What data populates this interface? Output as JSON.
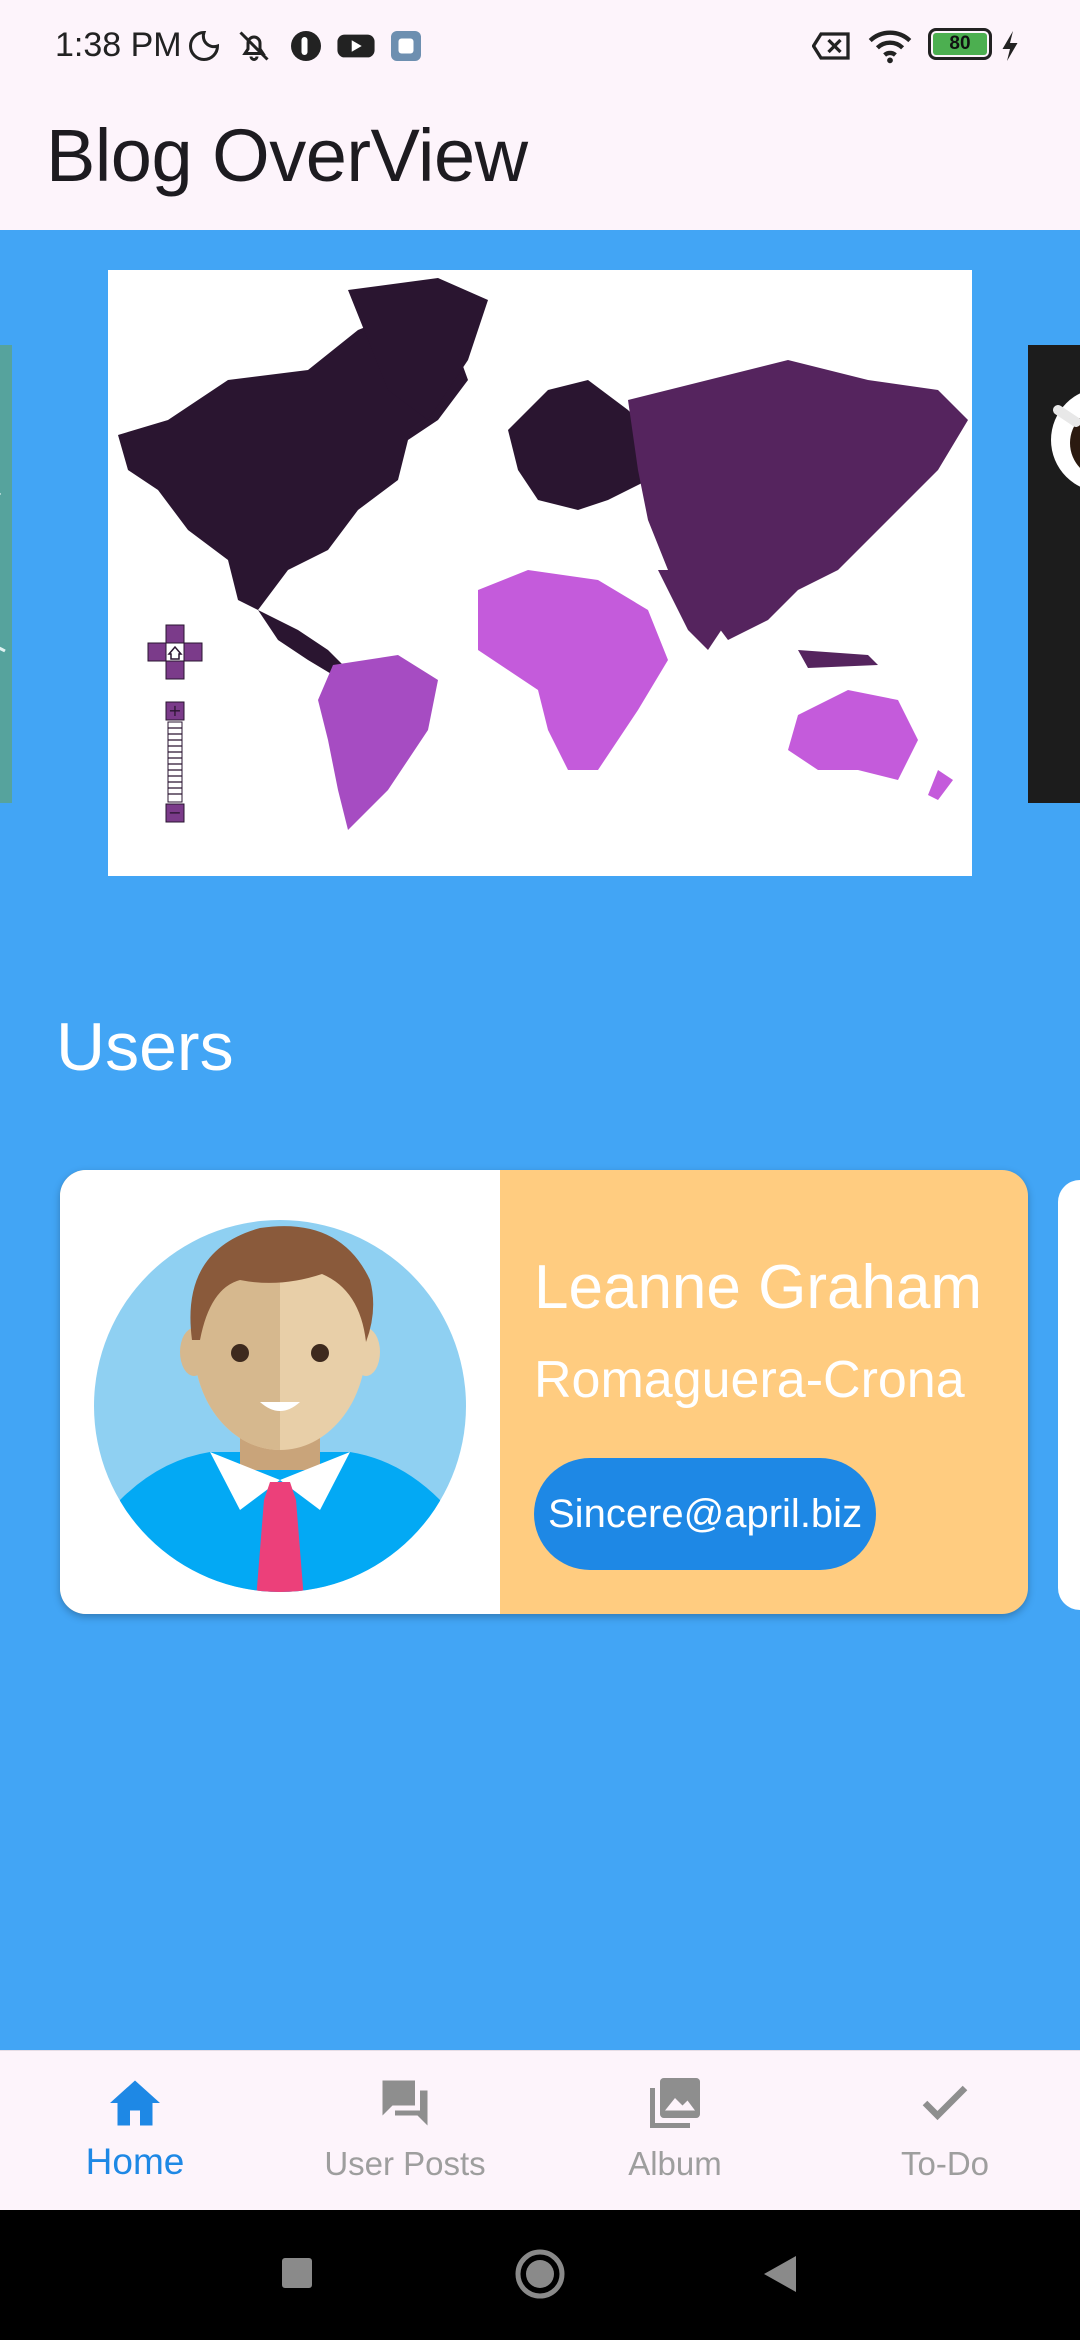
{
  "status_bar": {
    "time": "1:38 PM",
    "battery_level": "80",
    "icons": [
      "moon-icon",
      "mute-bell-icon",
      "app-icon",
      "youtube-icon",
      "gallery-icon",
      "no-sim-icon",
      "wifi-icon",
      "battery-icon",
      "charging-icon"
    ]
  },
  "app_bar": {
    "title": "Blog OverView"
  },
  "carousel": {
    "slides": [
      "world-map",
      "coffee-image",
      "teal-image"
    ]
  },
  "users_section": {
    "title": "Users",
    "users": [
      {
        "name": "Leanne Graham",
        "company": "Romaguera-Crona",
        "email": "Sincere@april.biz"
      }
    ]
  },
  "bottom_nav": {
    "items": [
      {
        "label": "Home",
        "icon": "home-icon",
        "active": true
      },
      {
        "label": "User Posts",
        "icon": "forum-icon",
        "active": false
      },
      {
        "label": "Album",
        "icon": "photo-library-icon",
        "active": false
      },
      {
        "label": "To-Do",
        "icon": "check-icon",
        "active": false
      }
    ]
  },
  "colors": {
    "background": "#42a5f5",
    "app_bar": "#fdf4fb",
    "card_accent": "#ffcc80",
    "email_button": "#1e88e5",
    "nav_active": "#1e88e5",
    "nav_inactive": "#9e9e9e"
  }
}
